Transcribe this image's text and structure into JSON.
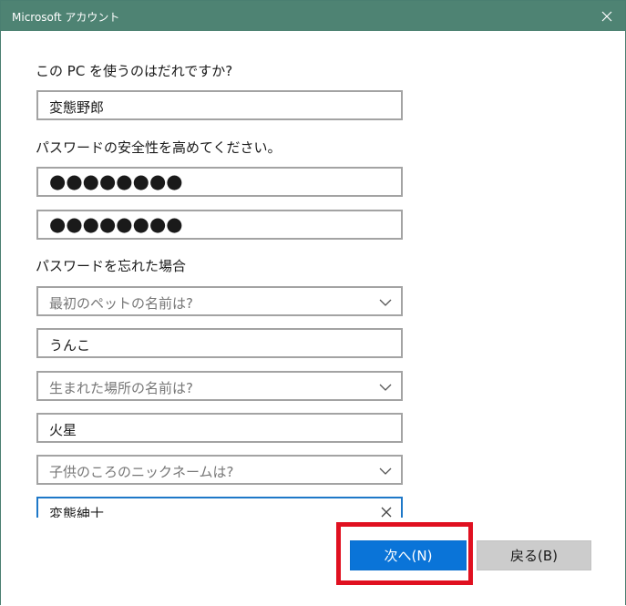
{
  "window": {
    "title": "Microsoft アカウント",
    "title_bar_color": "#4e8373"
  },
  "form": {
    "heading_who": "この PC を使うのはだれですか?",
    "username_value": "変態野郎",
    "heading_password": "パスワードの安全性を高めてください。",
    "password_value": "●●●●●●●●",
    "password_confirm_value": "●●●●●●●●",
    "heading_recovery": "パスワードを忘れた場合",
    "questions": [
      {
        "question": "最初のペットの名前は?",
        "answer": "うんこ"
      },
      {
        "question": "生まれた場所の名前は?",
        "answer": "火星"
      },
      {
        "question": "子供のころのニックネームは?",
        "answer": "変態紳士"
      }
    ]
  },
  "buttons": {
    "next_label": "次へ(N)",
    "back_label": "戻る(B)",
    "accent_color": "#0a74d8"
  },
  "annotation": {
    "highlight_color": "#e01020"
  }
}
